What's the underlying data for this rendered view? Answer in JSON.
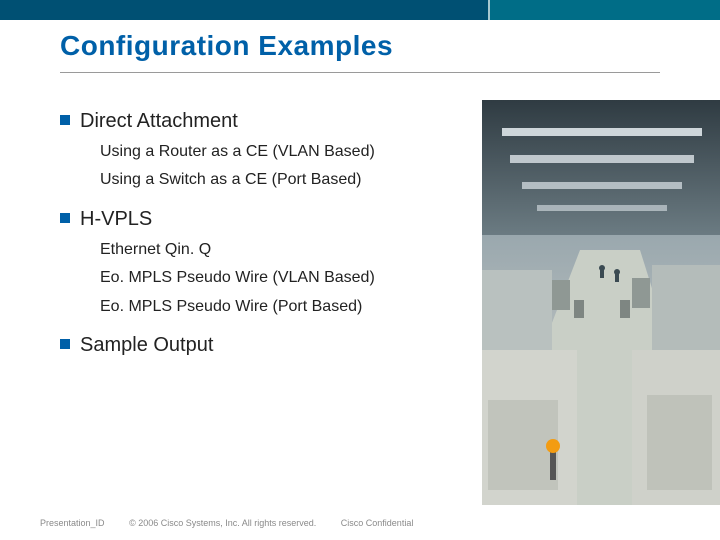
{
  "title": "Configuration Examples",
  "sections": [
    {
      "heading": "Direct Attachment",
      "subs": [
        "Using a Router as a CE (VLAN Based)",
        "Using a Switch as a CE (Port Based)"
      ]
    },
    {
      "heading": "H-VPLS",
      "subs": [
        "Ethernet Qin. Q",
        "Eo. MPLS Pseudo Wire (VLAN Based)",
        "Eo. MPLS Pseudo Wire (Port Based)"
      ]
    },
    {
      "heading": "Sample Output",
      "subs": []
    }
  ],
  "footer": {
    "id": "Presentation_ID",
    "copyright": "© 2006 Cisco Systems, Inc. All rights reserved.",
    "confidential": "Cisco Confidential"
  },
  "photo_alt": "factory-floor"
}
